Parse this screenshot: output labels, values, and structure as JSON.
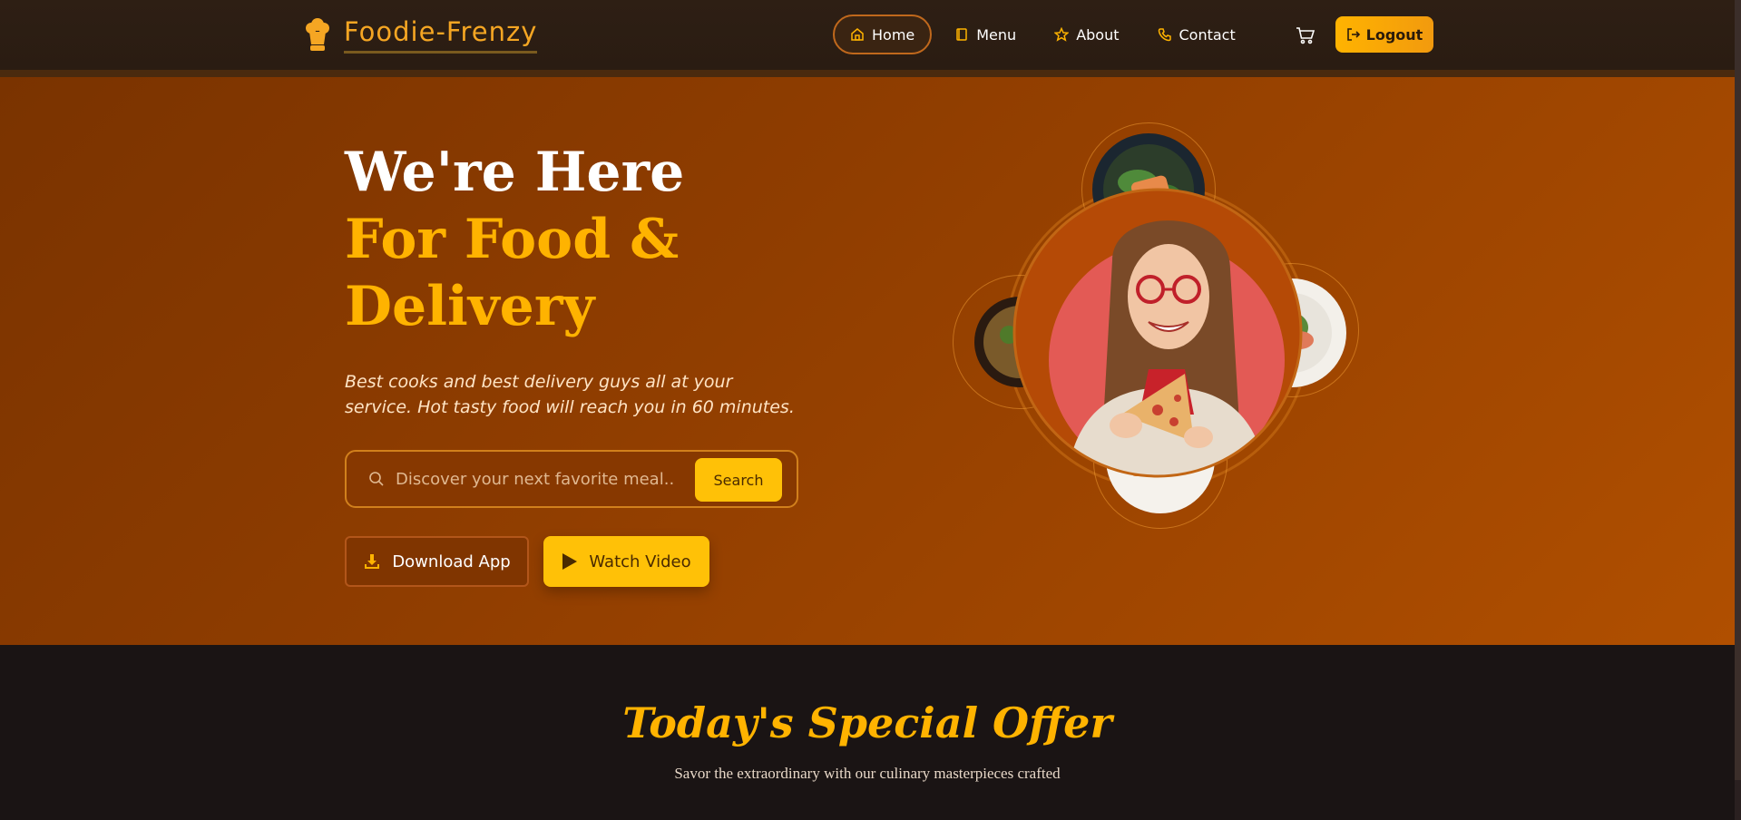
{
  "header": {
    "brand": "Foodie-Frenzy",
    "nav": [
      {
        "label": "Home",
        "icon": "home-icon",
        "active": true
      },
      {
        "label": "Menu",
        "icon": "book-icon",
        "active": false
      },
      {
        "label": "About",
        "icon": "star-icon",
        "active": false
      },
      {
        "label": "Contact",
        "icon": "phone-icon",
        "active": false
      }
    ],
    "logout_label": "Logout"
  },
  "hero": {
    "title_line1": "We're Here",
    "title_line2": "For Food &",
    "title_line3": "Delivery",
    "tagline": "Best cooks and best delivery guys all at your service. Hot tasty food will reach you in 60 minutes.",
    "search": {
      "placeholder": "Discover your next favorite meal..",
      "button_label": "Search"
    },
    "download_label": "Download App",
    "video_label": "Watch Video"
  },
  "special": {
    "title": "Today's Special Offer",
    "subtitle": "Savor the extraordinary with our culinary masterpieces crafted"
  },
  "colors": {
    "accent": "#ffb300",
    "hero_bg": "#8f3d00",
    "header_bg": "#2a1c12",
    "section_bg": "#1a1414"
  }
}
